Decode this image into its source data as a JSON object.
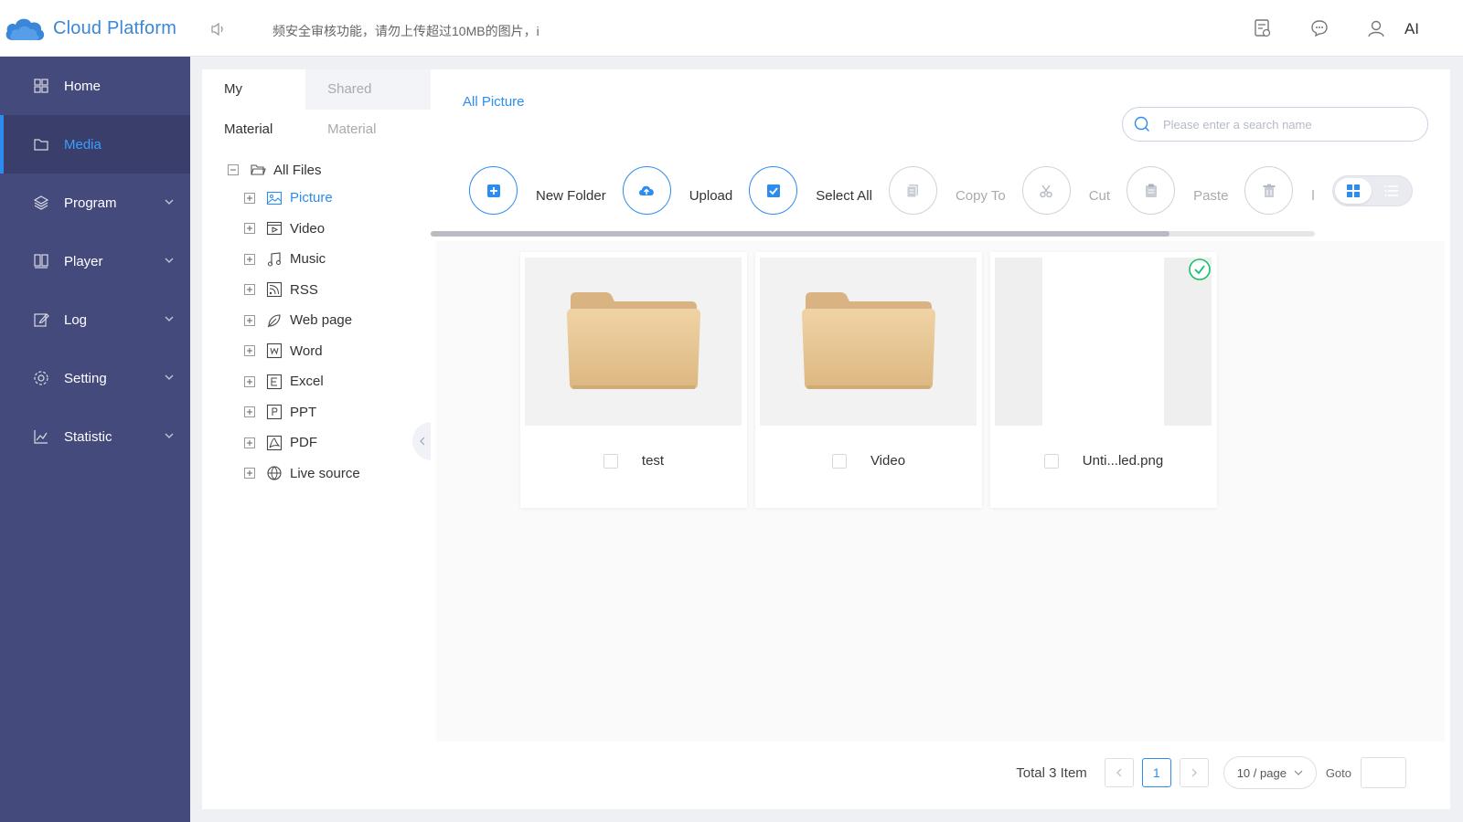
{
  "header": {
    "logo_text": "Cloud Platform",
    "notice": "频安全审核功能，请勿上传超过10MB的图片，i",
    "icons": [
      "report-icon",
      "message-icon",
      "user-icon"
    ],
    "user": "AI"
  },
  "sidebar": {
    "items": [
      {
        "label": "Home",
        "icon": "home-icon"
      },
      {
        "label": "Media",
        "icon": "media-icon"
      },
      {
        "label": "Program",
        "icon": "program-icon"
      },
      {
        "label": "Player",
        "icon": "player-icon"
      },
      {
        "label": "Log",
        "icon": "log-icon"
      },
      {
        "label": "Setting",
        "icon": "setting-icon"
      },
      {
        "label": "Statistic",
        "icon": "statistic-icon"
      }
    ],
    "active": "Media"
  },
  "tree_panel": {
    "tabs": [
      {
        "label": "My Material",
        "active": true
      },
      {
        "label": "Shared Material",
        "active": false
      }
    ],
    "root": "All Files",
    "nodes": [
      {
        "label": "Picture",
        "active": true
      },
      {
        "label": "Video"
      },
      {
        "label": "Music"
      },
      {
        "label": "RSS"
      },
      {
        "label": "Web page"
      },
      {
        "label": "Word"
      },
      {
        "label": "Excel"
      },
      {
        "label": "PPT"
      },
      {
        "label": "PDF"
      },
      {
        "label": "Live source"
      }
    ]
  },
  "main": {
    "breadcrumb": "All Picture",
    "search": {
      "placeholder": "Please enter a search name",
      "value": ""
    },
    "toolbar": {
      "new_folder": "New Folder",
      "upload": "Upload",
      "select_all": "Select All",
      "copy_to": "Copy To",
      "cut": "Cut",
      "paste": "Paste",
      "delete_label": "l"
    },
    "items": [
      {
        "name": "test",
        "type": "folder",
        "checked": false
      },
      {
        "name": "Video",
        "type": "folder",
        "checked": false
      },
      {
        "name": "Unti...led.png",
        "type": "image",
        "checked": false,
        "selected": true
      }
    ],
    "pagination": {
      "total": "Total 3 Item",
      "current_page": "1",
      "page_size": "10 / page",
      "goto": "Goto"
    }
  },
  "colors": {
    "sidebar_bg": "#454a7c",
    "sidebar_active_bg": "#393e6a",
    "accent": "#2d8cf0",
    "success": "#19be6b",
    "folder": "#e8c99a"
  }
}
